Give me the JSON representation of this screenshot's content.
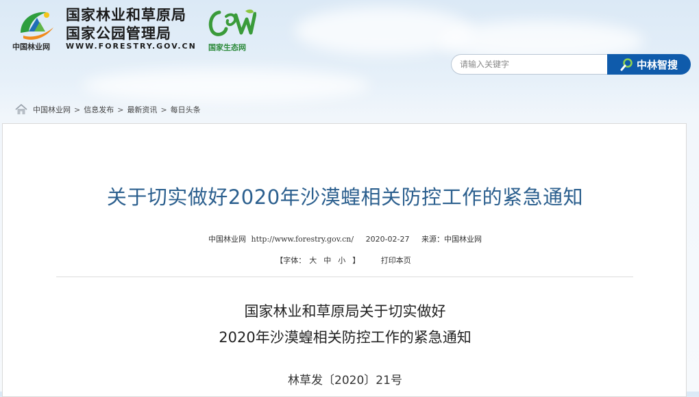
{
  "header": {
    "org_name_line1": "国家林业和草原局",
    "org_name_line2": "国家公园管理局",
    "site_url": "WWW.FORESTRY.GOV.CN",
    "logo_caption": "中国林业网",
    "eco_logo_caption": "国家生态网",
    "logo_icon": "forestry-emblem",
    "eco_icon": "cew-leaf-logo"
  },
  "search": {
    "placeholder": "请输入关键字",
    "value": "",
    "button_label": "中林智搜",
    "button_icon": "search-icon",
    "accent": "#0f5bab"
  },
  "breadcrumb": {
    "icon": "home-icon",
    "items": [
      "中国林业网",
      "信息发布",
      "最新资讯",
      "每日头条"
    ],
    "separator": ">"
  },
  "article": {
    "title": "关于切实做好2020年沙漠蝗相关防控工作的紧急通知",
    "meta": {
      "site": "中国林业网",
      "url": "http://www.forestry.gov.cn/",
      "date": "2020-02-27",
      "source": "来源：中国林业网"
    },
    "font_tools": {
      "label": "【字体：",
      "large": "大",
      "medium": "中",
      "small": "小",
      "close": "】",
      "print": "打印本页"
    },
    "doc_title_line1": "国家林业和草原局关于切实做好",
    "doc_title_line2": "2020年沙漠蝗相关防控工作的紧急通知",
    "doc_number": "林草发〔2020〕21号"
  },
  "colors": {
    "title": "#2b5f8e",
    "background_top": "#dbe9f6",
    "panel": "#ffffff"
  }
}
